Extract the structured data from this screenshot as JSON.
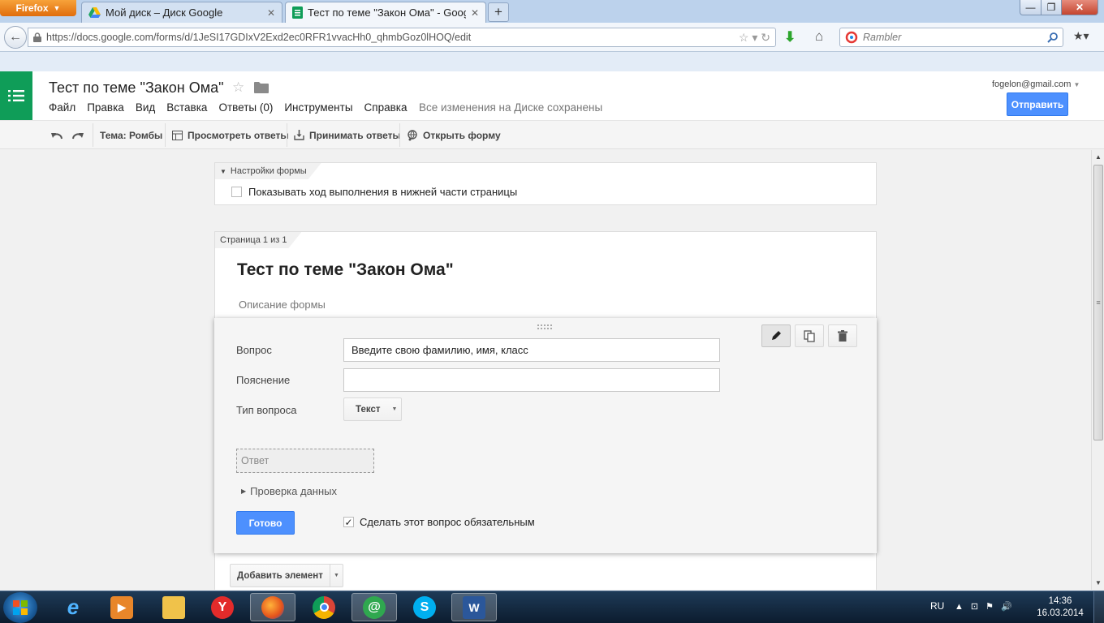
{
  "browser": {
    "menu_label": "Firefox",
    "tabs": [
      {
        "title": "Мой диск – Диск Google",
        "active": false
      },
      {
        "title": "Тест по теме \"Закон Ома\" - Google ...",
        "active": true
      }
    ],
    "new_tab_label": "+",
    "url": "https://docs.google.com/forms/d/1JeSI17GDIxV2Exd2ec0RFR1vvacHh0_qhmbGoz0lHOQ/edit",
    "search_engine": "Rambler",
    "window_buttons": {
      "minimize": "—",
      "maximize": "❐",
      "close": "✕"
    }
  },
  "app": {
    "doc_title": "Тест по теме \"Закон Ома\"",
    "menu": [
      "Файл",
      "Правка",
      "Вид",
      "Вставка",
      "Ответы (0)",
      "Инструменты",
      "Справка"
    ],
    "save_status": "Все изменения на Диске сохранены",
    "account": "fogelon@gmail.com",
    "send_label": "Отправить",
    "colors": {
      "brand": "#0f9d58",
      "primary": "#4d90fe"
    }
  },
  "toolbar": {
    "theme": "Тема: Ромбы",
    "view_responses": "Просмотреть ответы",
    "accept_responses": "Принимать ответы",
    "open_form": "Открыть форму"
  },
  "settings": {
    "section_label": "Настройки формы",
    "show_progress_label": "Показывать ход выполнения в нижней части страницы",
    "show_progress_checked": false
  },
  "page": {
    "label": "Страница 1 из 1",
    "form_title": "Тест по теме \"Закон Ома\"",
    "form_description": "Описание формы"
  },
  "question": {
    "title_label": "Вопрос",
    "title_value": "Введите свою фамилию, имя, класс",
    "help_label": "Пояснение",
    "help_value": "",
    "type_label": "Тип вопроса",
    "type_value": "Текст",
    "answer_placeholder": "Ответ",
    "validation_label": "Проверка данных",
    "done_label": "Готово",
    "required_label": "Сделать этот вопрос обязательным",
    "required_checked": true
  },
  "add_element_label": "Добавить элемент",
  "taskbar": {
    "language": "RU",
    "time": "14:36",
    "date": "16.03.2014"
  }
}
